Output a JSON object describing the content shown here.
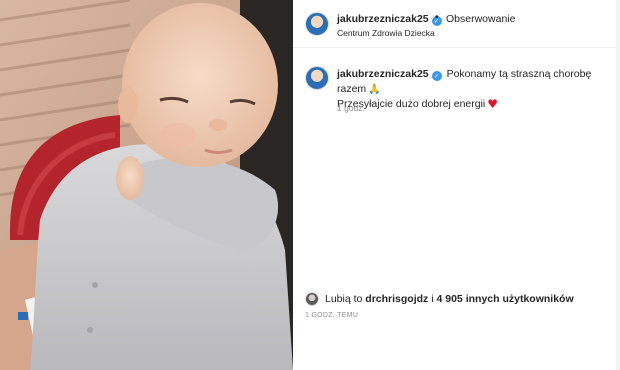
{
  "header": {
    "username": "jakubrzezniczak25",
    "verified_icon": "verified-badge-icon",
    "separator": "•",
    "follow_label": "Obserwowanie",
    "location": "Centrum Zdrowia Dziecka"
  },
  "caption": {
    "username": "jakubrzezniczak25",
    "line1": "Pokonamy tą straszną chorobę razem",
    "line2": "Przesyłajcie dużo dobrej energii",
    "time": "1 godz.",
    "icons": [
      "praying-hands-icon",
      "red-heart-icon"
    ]
  },
  "likes": {
    "prefix": "Lubią to",
    "user": "drchrisgojdz",
    "connector": "i",
    "others": "4 905 innych użytkowników"
  },
  "post_time": "1 GODZ. TEMU",
  "colors": {
    "verified": "#3897f0",
    "heart": "#e0152e",
    "text": "#262626",
    "muted": "#8e8e8e"
  }
}
